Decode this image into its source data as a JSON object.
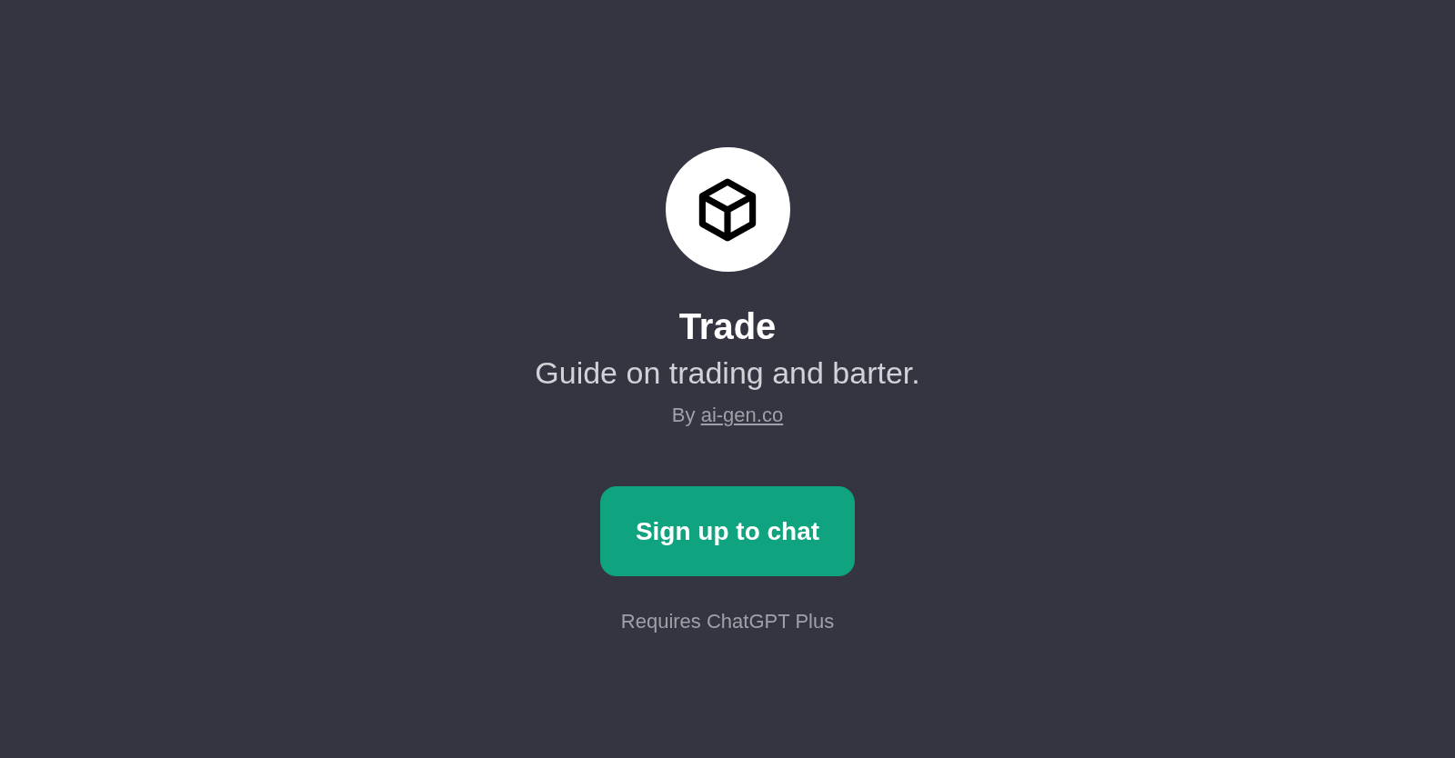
{
  "title": "Trade",
  "description": "Guide on trading and barter.",
  "author": {
    "prefix": "By",
    "link": "ai-gen.co"
  },
  "button": {
    "label": "Sign up to chat"
  },
  "note": "Requires ChatGPT Plus"
}
